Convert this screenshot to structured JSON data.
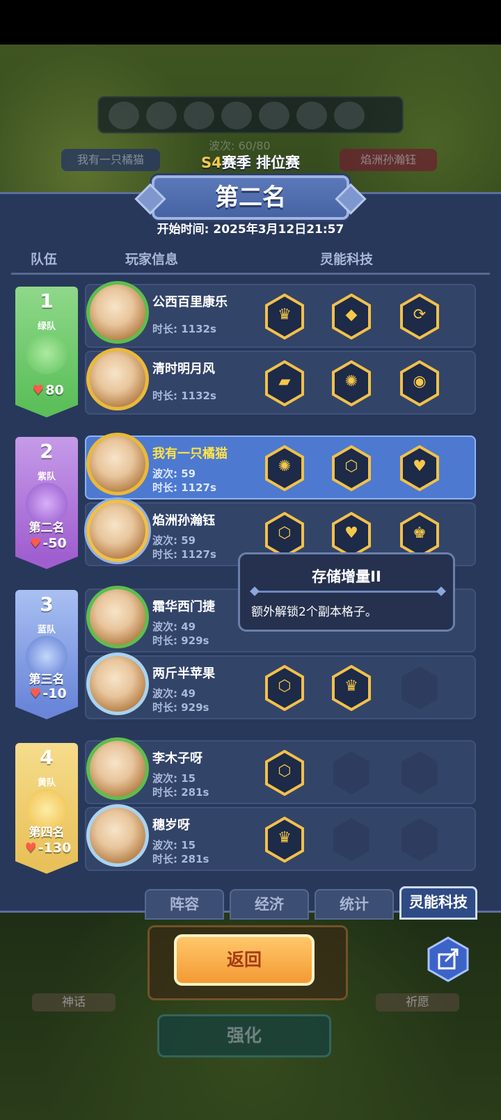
{
  "game_bg": {
    "wave_text": "波次: 60/80",
    "left_player": "我有一只橘猫",
    "right_player": "焰洲孙瀚钰",
    "myth_label": "神话",
    "wish_label": "祈愿",
    "strengthen_label": "强化"
  },
  "header": {
    "season_prefix": "S4",
    "season_suffix": "赛季 排位赛",
    "rank_title": "第二名",
    "start_time": "开始时间: 2025年3月12日21:57"
  },
  "columns": {
    "team": "队伍",
    "player_info": "玩家信息",
    "tech": "灵能科技"
  },
  "teams": [
    {
      "number": "1",
      "name": "绿队",
      "rank": "",
      "score": "80",
      "color": "#5cbf5a"
    },
    {
      "number": "2",
      "name": "紫队",
      "rank": "第二名",
      "score": "-50",
      "color": "#a05fd0"
    },
    {
      "number": "3",
      "name": "蓝队",
      "rank": "第三名",
      "score": "-10",
      "color": "#6a86d8"
    },
    {
      "number": "4",
      "name": "黄队",
      "rank": "第四名",
      "score": "-130",
      "color": "#e8c15a"
    }
  ],
  "players": [
    {
      "name": "公西百里康乐",
      "wave": "",
      "time": "时长: 1132s",
      "techs": [
        "crown-icon",
        "gem-icon",
        "coin-arrow-icon"
      ]
    },
    {
      "name": "清时明月风",
      "wave": "",
      "time": "时长: 1132s",
      "techs": [
        "card-icon",
        "swirl-icon",
        "eye-icon"
      ]
    },
    {
      "name": "我有一只橘猫",
      "wave": "波次: 59",
      "time": "时长: 1127s",
      "techs": [
        "swirl-icon",
        "storage-icon",
        "heart-percent-icon"
      ]
    },
    {
      "name": "焰洲孙瀚钰",
      "wave": "波次: 59",
      "time": "时长: 1127s",
      "techs": [
        "storage-icon",
        "heart-wave-icon",
        "chess-icon"
      ]
    },
    {
      "name": "霜华西门捷",
      "wave": "波次: 49",
      "time": "时长: 929s",
      "techs": []
    },
    {
      "name": "两斤半苹果",
      "wave": "波次: 49",
      "time": "时长: 929s",
      "techs": [
        "storage-icon",
        "crown-icon"
      ]
    },
    {
      "name": "李木子呀",
      "wave": "波次: 15",
      "time": "时长: 281s",
      "techs": [
        "storage-icon"
      ]
    },
    {
      "name": "穗岁呀",
      "wave": "波次: 15",
      "time": "时长: 281s",
      "techs": [
        "crown-icon"
      ]
    }
  ],
  "tooltip": {
    "title": "存储增量II",
    "desc": "额外解锁2个副本格子。"
  },
  "tabs": [
    "阵容",
    "经济",
    "统计",
    "灵能科技"
  ],
  "back_button": "返回"
}
